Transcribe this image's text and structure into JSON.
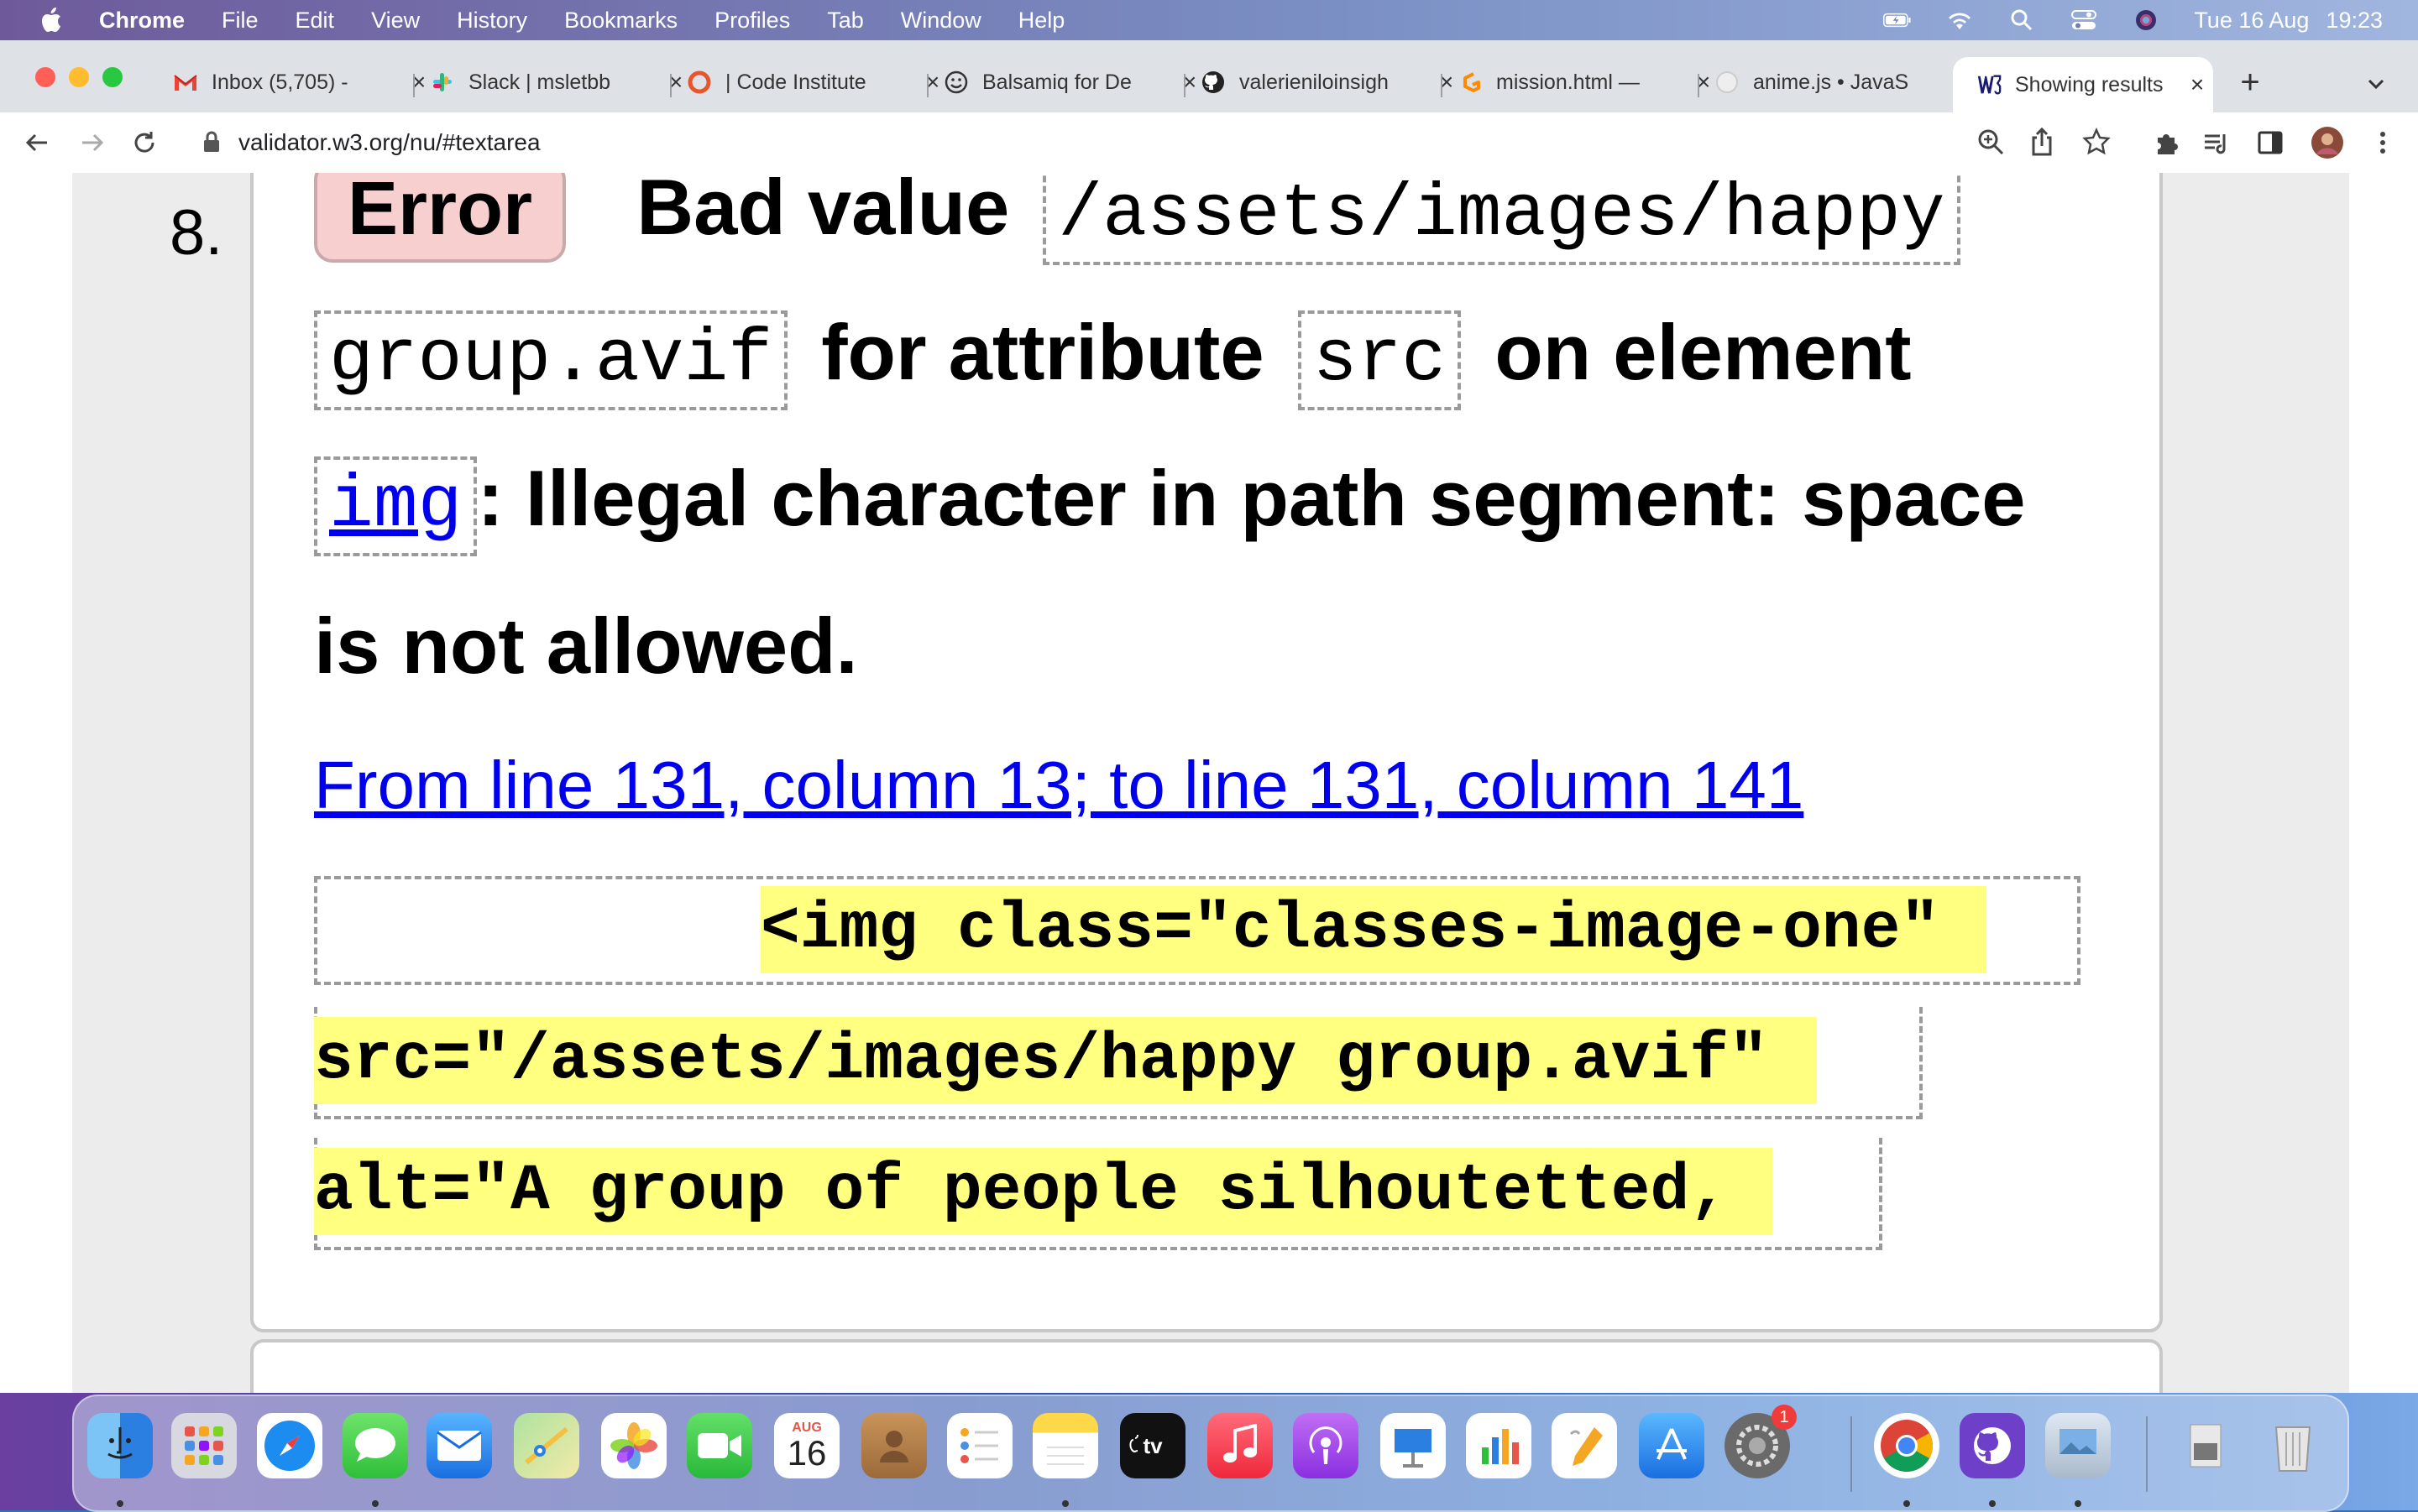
{
  "menubar": {
    "app_name": "Chrome",
    "items": [
      "File",
      "Edit",
      "View",
      "History",
      "Bookmarks",
      "Profiles",
      "Tab",
      "Window",
      "Help"
    ],
    "date": "Tue 16 Aug",
    "time": "19:23"
  },
  "tabs": [
    {
      "label": "Inbox (5,705) -",
      "icon": "gmail-icon"
    },
    {
      "label": "Slack | msletbb",
      "icon": "slack-icon"
    },
    {
      "label": "| Code Institute",
      "icon": "code-institute-icon"
    },
    {
      "label": "Balsamiq for De",
      "icon": "balsamiq-icon"
    },
    {
      "label": "valerieniloinsigh",
      "icon": "github-icon"
    },
    {
      "label": "mission.html —",
      "icon": "gitpod-icon"
    },
    {
      "label": "anime.js • JavaS",
      "icon": "anime-icon"
    },
    {
      "label": "Showing results",
      "icon": "w3c-validator-icon"
    }
  ],
  "address_bar": {
    "url": "validator.w3.org/nu/#textarea"
  },
  "message": {
    "number": "8.",
    "type_label": "Error",
    "text_bad_value": "Bad value",
    "value_part1": "/assets/images/happy",
    "value_part2": "group.avif",
    "text_for_attribute": "for attribute",
    "attribute": "src",
    "text_on_element": "on element",
    "element": "img",
    "text_detail_1": ": Illegal character in path segment: space",
    "text_detail_2": "is not allowed.",
    "location": "From line 131, column 13; to line 131, column 141",
    "extract_line_1": "<img class=\"classes-image-one\"",
    "extract_line_2": "src=\"/assets/images/happy group.avif\"",
    "extract_line_3": "alt=\"A group of people silhoutetted,"
  },
  "dock": {
    "calendar_month": "AUG",
    "calendar_day": "16",
    "settings_badge": "1",
    "apps": [
      "Finder",
      "Launchpad",
      "Safari",
      "Messages",
      "Mail",
      "Maps",
      "Photos",
      "FaceTime",
      "Calendar",
      "Contacts",
      "Reminders",
      "Notes",
      "TV",
      "Music",
      "Podcasts",
      "Keynote",
      "Numbers",
      "Pages",
      "App Store",
      "System Preferences",
      "Chrome",
      "GitHub Desktop",
      "Preview",
      "Downloads",
      "Trash"
    ]
  }
}
